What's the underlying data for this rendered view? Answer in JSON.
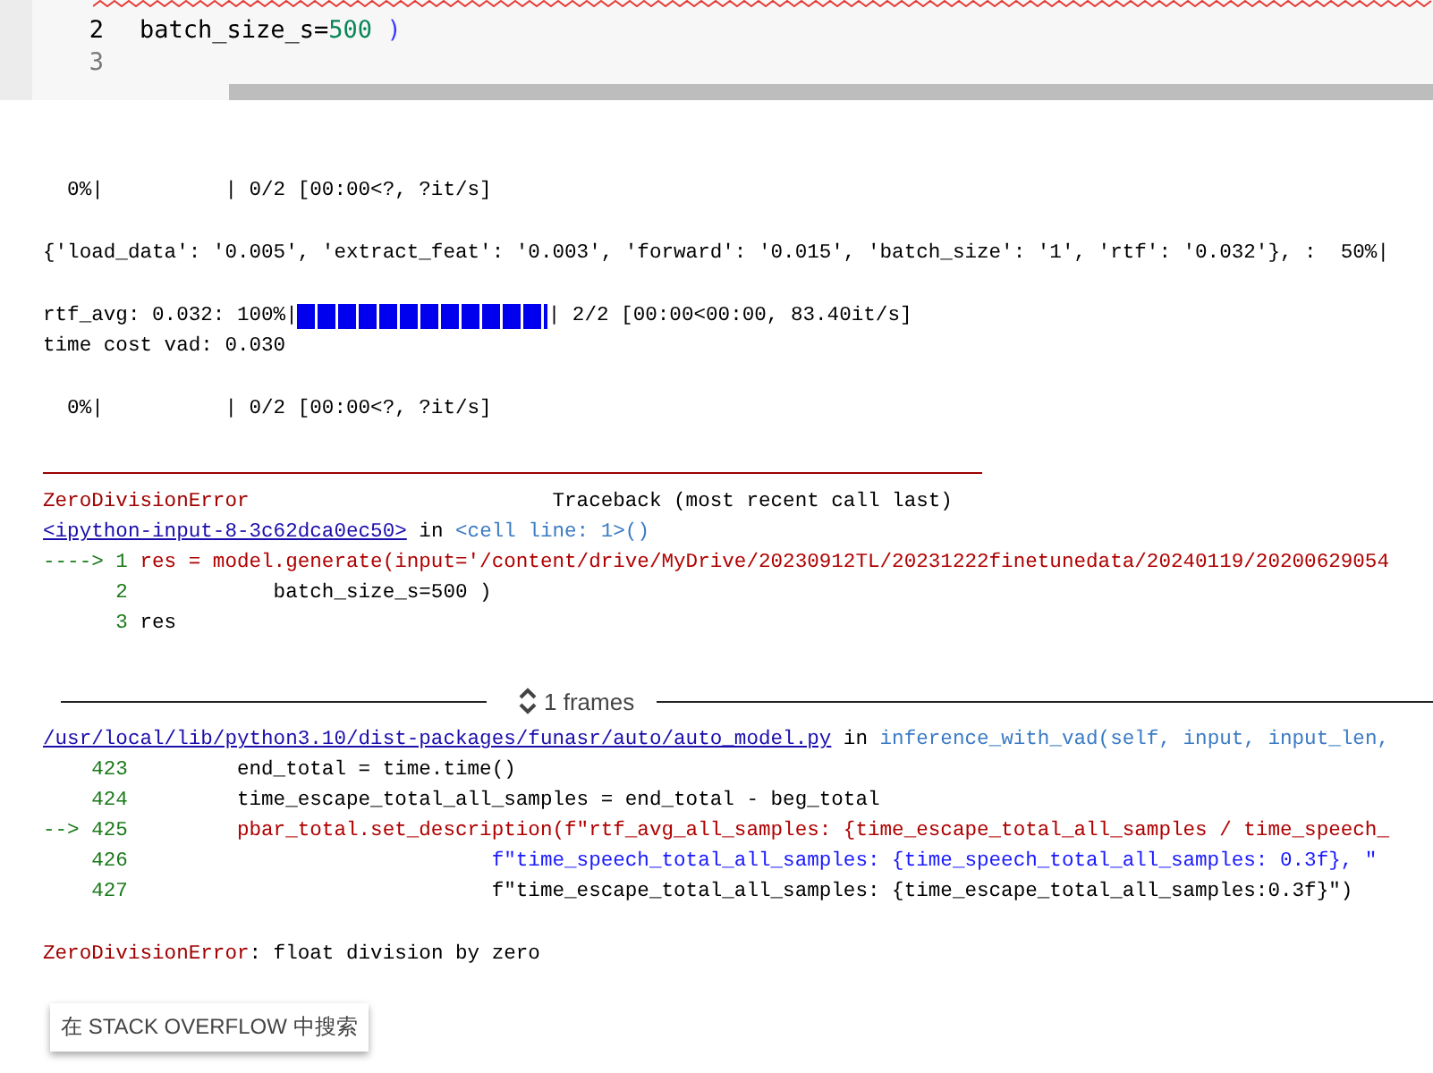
{
  "code_cell": {
    "lines": [
      {
        "number": "2",
        "tokens": [
          {
            "text": "batch_size_s=",
            "kind": "text"
          },
          {
            "text": "500",
            "kind": "number"
          },
          {
            "text": " )",
            "kind": "paren"
          }
        ]
      },
      {
        "number": "3"
      }
    ]
  },
  "output": {
    "blocks": [
      {
        "lines": [
          {
            "kind": "text",
            "segments": [
              {
                "text": "  0%|          | 0/2 [00:00<?, ?it/s]",
                "kind": "text"
              }
            ]
          }
        ]
      },
      {
        "lines": [
          {
            "kind": "text",
            "segments": [
              {
                "text": "{'load_data': '0.005', 'extract_feat': '0.003', 'forward': '0.015', 'batch_size': '1', 'rtf': '0.032'}, :  50%|",
                "kind": "text"
              }
            ]
          }
        ]
      },
      {
        "lines": [
          {
            "kind": "progress",
            "prefix": "rtf_avg: 0.032: 100%|",
            "level": 1,
            "suffix": "| 2/2 [00:00<00:00, 83.40it/s]"
          },
          {
            "kind": "text",
            "segments": [
              {
                "text": "time cost vad: 0.030",
                "kind": "text"
              }
            ]
          }
        ]
      },
      {
        "lines": [
          {
            "kind": "text",
            "segments": [
              {
                "text": "  0%|          | 0/2 [00:00<?, ?it/s]",
                "kind": "text"
              }
            ]
          }
        ]
      },
      {
        "lines": [
          {
            "kind": "rule"
          },
          {
            "kind": "text",
            "segments": [
              {
                "text": "ZeroDivisionError",
                "kind": "exception"
              },
              {
                "text": "                         Traceback (most recent call last)",
                "kind": "text"
              }
            ]
          },
          {
            "kind": "text",
            "segments": [
              {
                "text": "<ipython-input-8-3c62dca0ec50>",
                "kind": "link"
              },
              {
                "text": " in ",
                "kind": "text"
              },
              {
                "text": "<cell line: 1>()",
                "kind": "function"
              }
            ]
          },
          {
            "kind": "text",
            "segments": [
              {
                "text": "----> 1 ",
                "kind": "lineno"
              },
              {
                "text": "res = model.generate(input='/content/drive/MyDrive/20230912TL/20231222finetunedata/20240119/20200629054",
                "kind": "current"
              }
            ]
          },
          {
            "kind": "text",
            "segments": [
              {
                "text": "      2 ",
                "kind": "lineno"
              },
              {
                "text": "           batch_size_s=500 )",
                "kind": "text"
              }
            ]
          },
          {
            "kind": "text",
            "segments": [
              {
                "text": "      3 ",
                "kind": "lineno"
              },
              {
                "text": "res",
                "kind": "text"
              }
            ]
          }
        ]
      },
      {
        "lines": [
          {
            "kind": "frames",
            "label": "1 frames",
            "expanded": false
          },
          {
            "kind": "text",
            "segments": [
              {
                "text": "/usr/local/lib/python3.10/dist-packages/funasr/auto/auto_model.py",
                "kind": "link"
              },
              {
                "text": " in ",
                "kind": "text"
              },
              {
                "text": "inference_with_vad(self, input, input_len,",
                "kind": "function"
              }
            ]
          },
          {
            "kind": "text",
            "segments": [
              {
                "text": "    423 ",
                "kind": "lineno"
              },
              {
                "text": "        end_total = time.time()",
                "kind": "text"
              }
            ]
          },
          {
            "kind": "text",
            "segments": [
              {
                "text": "    424 ",
                "kind": "lineno"
              },
              {
                "text": "        time_escape_total_all_samples = end_total - beg_total",
                "kind": "text"
              }
            ]
          },
          {
            "kind": "text",
            "segments": [
              {
                "text": "--> 425 ",
                "kind": "lineno"
              },
              {
                "text": "        pbar_total.set_description(f\"rtf_avg_all_samples: {time_escape_total_all_samples / time_speech_",
                "kind": "current"
              }
            ]
          },
          {
            "kind": "text",
            "segments": [
              {
                "text": "    426 ",
                "kind": "lineno"
              },
              {
                "text": "                             f\"time_speech_total_all_samples: {time_speech_total_all_samples: 0.3f}, \"",
                "kind": "string"
              }
            ]
          },
          {
            "kind": "text",
            "segments": [
              {
                "text": "    427 ",
                "kind": "lineno"
              },
              {
                "text": "                             f\"time_escape_total_all_samples: {time_escape_total_all_samples:0.3f}\")",
                "kind": "text"
              }
            ]
          }
        ]
      },
      {
        "lines": [
          {
            "kind": "text",
            "segments": [
              {
                "text": "ZeroDivisionError",
                "kind": "exception"
              },
              {
                "text": ": float division by zero",
                "kind": "text"
              }
            ]
          }
        ]
      }
    ]
  },
  "search_button": {
    "label": "在 STACK OVERFLOW 中搜索"
  }
}
